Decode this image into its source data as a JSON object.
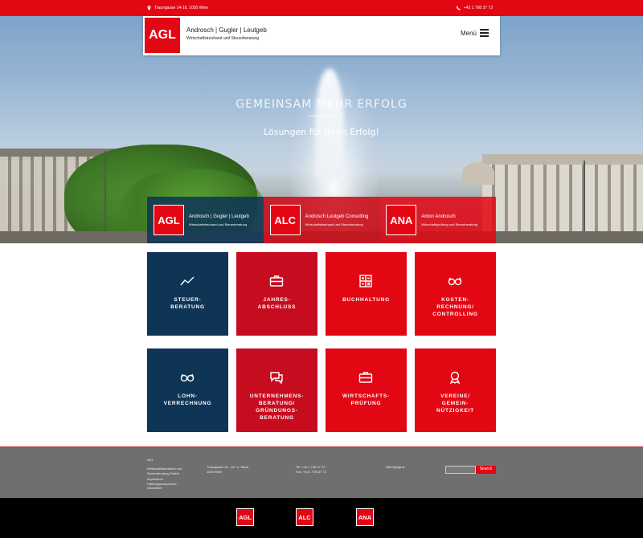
{
  "topbar": {
    "address": "Traungasse 14-16, 1030 Wien",
    "phone": "+43 1 798 37 73"
  },
  "header": {
    "logo": "AGL",
    "brand_name": "Androsch | Gugler | Leutgeb",
    "brand_sub": "Wirtschaftstreuhand und Steuerberatung",
    "menu_label": "Menü"
  },
  "hero": {
    "title": "GEMEINSAM MEHR ERFOLG",
    "subtitle": "Lösungen für Ihren Erfolg!"
  },
  "companies": [
    {
      "abbr": "AGL",
      "name": "Androsch | Gugler | Leutgeb",
      "desc": "Wirtschaftstreuhand und Steuerberatung"
    },
    {
      "abbr": "ALC",
      "name": "Androsch Leutgeb Consulting",
      "desc": "Wirtschaftstreuhand und Steuerberatung"
    },
    {
      "abbr": "ANA",
      "name": "Anton Androsch",
      "desc": "Wirtschaftsprüfung und Steuerberatung"
    }
  ],
  "tiles": [
    {
      "label": "STEUER-\nBERATUNG",
      "icon": "chart-line-icon"
    },
    {
      "label": "JAHRES-\nABSCHLUSS",
      "icon": "briefcase-icon"
    },
    {
      "label": "BUCHHALTUNG",
      "icon": "calculator-icon"
    },
    {
      "label": "KOSTEN-\nRECHNUNG/\nCONTROLLING",
      "icon": "glasses-icon"
    },
    {
      "label": "LOHN-\nVERRECHNUNG",
      "icon": "glasses-icon"
    },
    {
      "label": "UNTERNEHMENS-\nBERATUNG/\nGRÜNDUNGS-\nBERATUNG",
      "icon": "chat-bubbles-icon"
    },
    {
      "label": "WIRTSCHAFTS-\nPRÜFUNG",
      "icon": "briefcase-icon"
    },
    {
      "label": "VEREINE/\nGEMEIN-\nNÜTZIGKEIT",
      "icon": "award-ribbon-icon"
    }
  ],
  "footer": {
    "company": "AGL\n\nWirtschaftstreuhand und\nSteuerberatung GmbH",
    "links": "Impressum\nHaftungsausschluss /\nDisclaimer",
    "address": "Traungasse 14 - 16 / 4. Stock\n1030 Wien",
    "contact": "Tel: +43 1 798 37 73\nFax: +43 1 798 37 73",
    "email": "office@agl.at",
    "search_label": "Search"
  },
  "bottom_logos": [
    "AGL",
    "ALC",
    "ANA"
  ],
  "colors": {
    "brand_red": "#e30613",
    "dark_red": "#c70c1f",
    "navy": "#0e3456"
  }
}
